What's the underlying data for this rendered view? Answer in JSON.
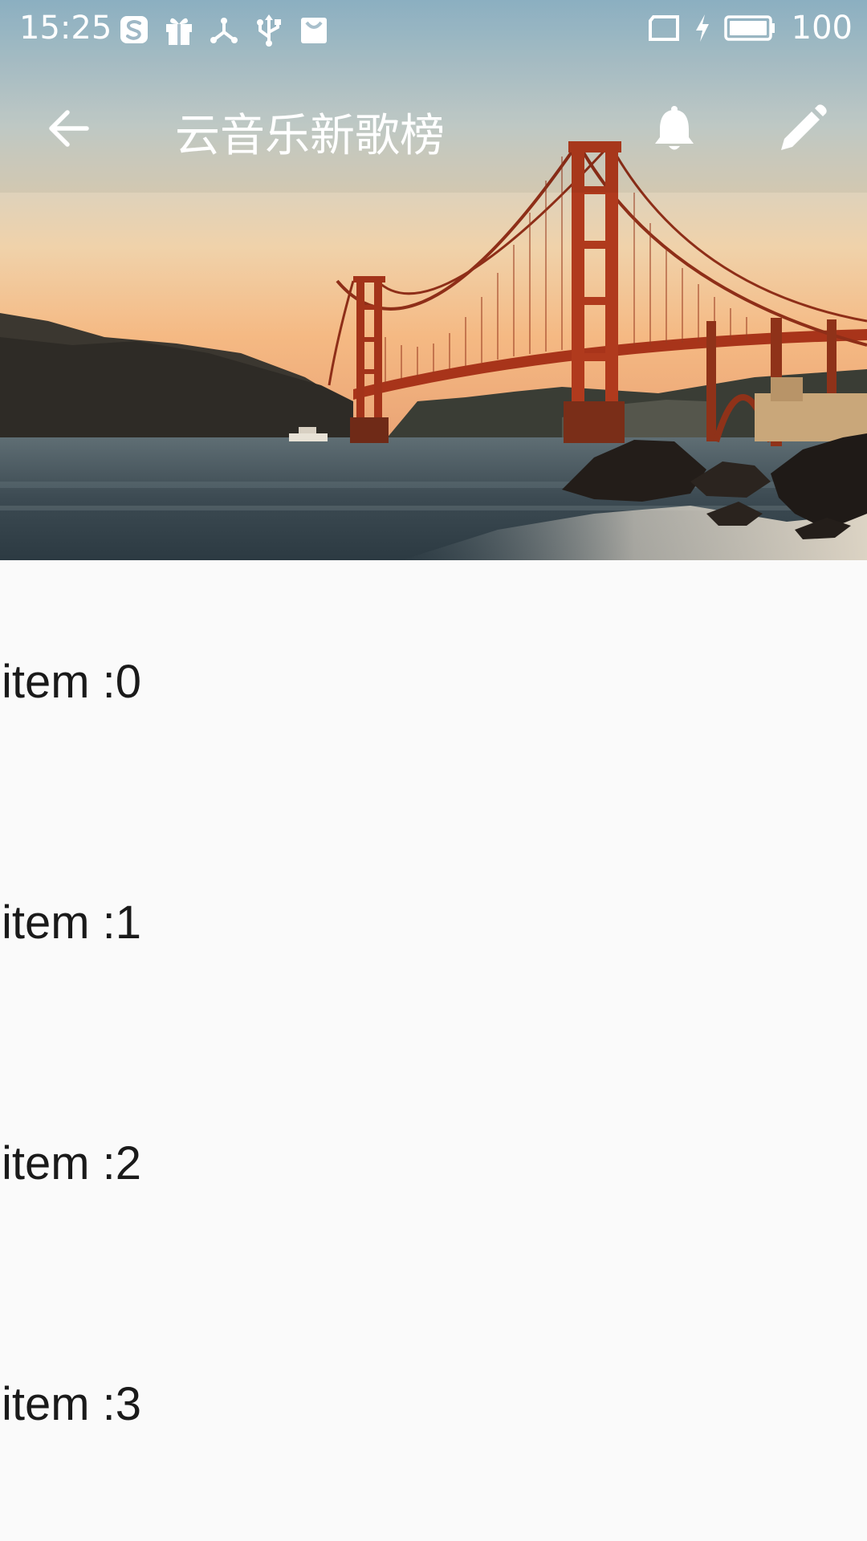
{
  "status_bar": {
    "time": "15:25",
    "left_icons": [
      "s-app-icon",
      "gift-icon",
      "share-nodes-icon",
      "usb-icon",
      "mail-icon"
    ],
    "right_icons": [
      "tablet-icon",
      "charging-bolt-icon",
      "battery-icon"
    ],
    "battery_level": "100"
  },
  "toolbar": {
    "title": "云音乐新歌榜",
    "back_icon": "arrow-left-icon",
    "actions": [
      "bell-icon",
      "pencil-icon"
    ]
  },
  "list": {
    "items": [
      {
        "label": "item :0"
      },
      {
        "label": "item :1"
      },
      {
        "label": "item :2"
      },
      {
        "label": "item :3"
      }
    ]
  },
  "colors": {
    "toolbar_text": "#ffffff",
    "list_background": "#fafafa",
    "item_text": "#1a1a1a",
    "bridge": "#b23a1e"
  }
}
